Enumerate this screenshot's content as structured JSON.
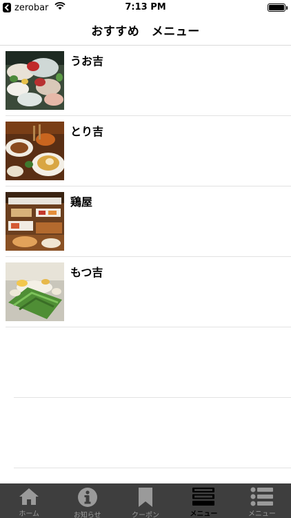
{
  "status_bar": {
    "carrier": "zerobar",
    "time": "7:13 PM",
    "battery_level": 1.0
  },
  "nav": {
    "title": "おすすめ　メニュー"
  },
  "menu_items": [
    {
      "title": "うお吉",
      "image": "sashimi-platter-photo"
    },
    {
      "title": "とり吉",
      "image": "yakitori-dishes-photo"
    },
    {
      "title": "鶏屋",
      "image": "chicken-course-photo"
    },
    {
      "title": "もつ吉",
      "image": "motsunabe-photo"
    }
  ],
  "tab_bar": {
    "tabs": [
      {
        "label": "ホーム",
        "icon": "house-icon",
        "active": false
      },
      {
        "label": "お知らせ",
        "icon": "info-icon",
        "active": false
      },
      {
        "label": "クーポン",
        "icon": "bookmark-icon",
        "active": false
      },
      {
        "label": "メニュー",
        "icon": "menu-panel-icon",
        "active": true
      },
      {
        "label": "メニュー",
        "icon": "list-icon",
        "active": false
      }
    ]
  },
  "colors": {
    "tab_bar_bg": "#3e3e3e",
    "tab_inactive": "#9a9a9a",
    "tab_active": "#000000"
  }
}
